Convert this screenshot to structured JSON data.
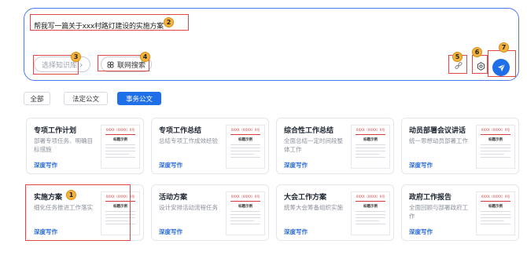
{
  "prompt": {
    "text": "帮我写一篇关于xxx村路灯建设的实施方案",
    "knowledge_base_placeholder": "选择知识库",
    "web_search_label": "联网搜索"
  },
  "icons": {
    "kb_chevron": "chevron-right-icon",
    "web": "globe-icon",
    "link": "link-icon",
    "settings": "gear-icon",
    "send": "send-icon"
  },
  "tabs": [
    {
      "label": "全部",
      "active": false
    },
    {
      "label": "法定公文",
      "active": false
    },
    {
      "label": "事务公文",
      "active": true
    }
  ],
  "cards": [
    {
      "title": "专项工作计划",
      "desc": "部署专项任务、明确目标措施",
      "link": "深度写作"
    },
    {
      "title": "专项工作总结",
      "desc": "总结专项工作成效经验",
      "link": "深度写作"
    },
    {
      "title": "综合性工作总结",
      "desc": "全面总结一定时间段整体工作",
      "link": "深度写作"
    },
    {
      "title": "动员部署会议讲话",
      "desc": "统一思想动员部署工作",
      "link": "深度写作"
    },
    {
      "title": "实施方案",
      "desc": "细化任务推进工作落实",
      "link": "深度写作"
    },
    {
      "title": "活动方案",
      "desc": "设计安排活动流程任务",
      "link": "深度写作"
    },
    {
      "title": "大会工作方案",
      "desc": "统筹大会筹备组织实施",
      "link": "深度写作"
    },
    {
      "title": "政府工作报告",
      "desc": "全面回顾与部署政府工作",
      "link": "深度写作"
    }
  ],
  "thumbnail": {
    "header": "XXXX（XXXX）X号",
    "title": "标题示例"
  },
  "annotations": [
    "1",
    "2",
    "3",
    "4",
    "5",
    "6",
    "7"
  ],
  "colors": {
    "accent": "#1f6fe8",
    "annotation_box": "#e04848",
    "annotation_badge": "#f3b33d"
  }
}
